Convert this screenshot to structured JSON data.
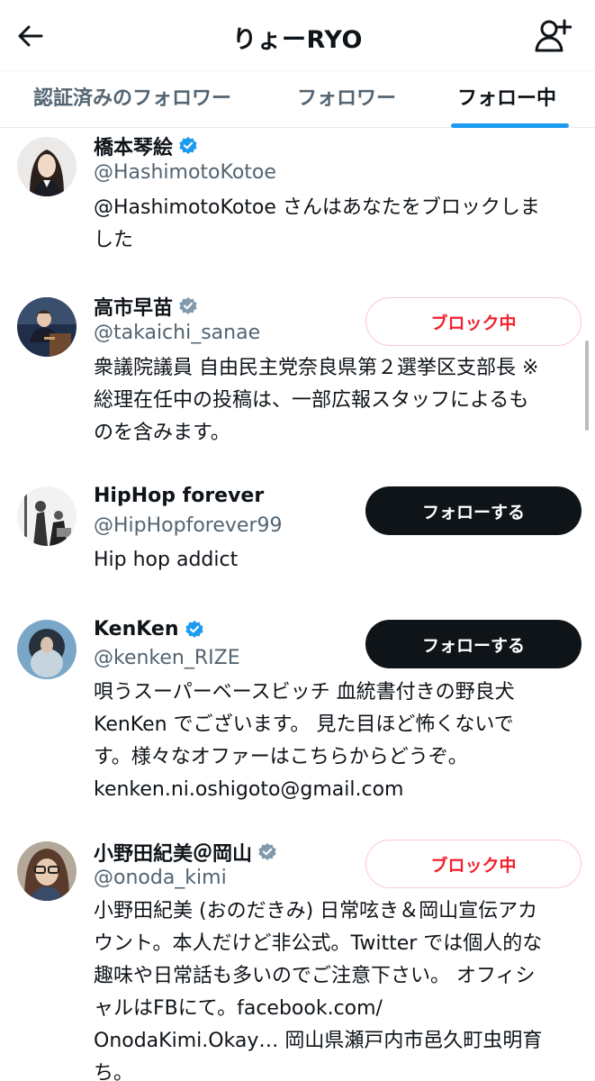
{
  "header": {
    "title": "りょーRYO",
    "back_icon": "arrow-left-icon",
    "add_user_icon": "person-add-icon"
  },
  "tabs": [
    {
      "label": "認証済みのフォロワー",
      "active": false
    },
    {
      "label": "フォロワー",
      "active": false
    },
    {
      "label": "フォロー中",
      "active": true
    }
  ],
  "colors": {
    "accent": "#1d9bf0",
    "verified_blue": "#1d9bf0",
    "verified_gray": "#829aab",
    "blocked_red": "#f4212e",
    "follow_button": "#0f1419"
  },
  "users": [
    {
      "name": "橋本琴絵",
      "verified": "blue",
      "handle": "@HashimotoKotoe",
      "bio_lines": [
        "@HashimotoKotoe さんはあなたをブロックしま",
        "した"
      ],
      "button": ""
    },
    {
      "name": "高市早苗",
      "verified": "gray",
      "handle": "@takaichi_sanae",
      "bio_lines": [
        "衆議院議員 自由民主党奈良県第２選挙区支部長 ※",
        "総理在任中の投稿は、一部広報スタッフによるも",
        "のを含みます。"
      ],
      "button": "ブロック中"
    },
    {
      "name": "HipHop forever",
      "verified": "none",
      "handle": "@HipHopforever99",
      "bio_lines": [
        "Hip hop addict"
      ],
      "button": "フォローする"
    },
    {
      "name": "KenKen",
      "verified": "blue",
      "handle": "@kenken_RIZE",
      "bio_lines": [
        "唄うスーパーベースビッチ 血統書付きの野良犬",
        "KenKen でございます。 見た目ほど怖くないで",
        "す。様々なオファーはこちらからどうぞ。",
        "kenken.ni.oshigoto@gmail.com"
      ],
      "button": "フォローする"
    },
    {
      "name": "小野田紀美＠岡山",
      "verified": "gray",
      "handle": "@onoda_kimi",
      "bio_lines": [
        "小野田紀美 (おのだきみ) 日常呟き＆岡山宣伝アカ",
        "ウント。本人だけど非公式。Twitter では個人的な",
        "趣味や日常話も多いのでご注意下さい。 オフィシ",
        "ャルはFBにて。facebook.com/",
        "OnodaKimi.Okay… 岡山県瀬戸内市邑久町虫明育",
        "ち。"
      ],
      "button": "ブロック中"
    }
  ]
}
